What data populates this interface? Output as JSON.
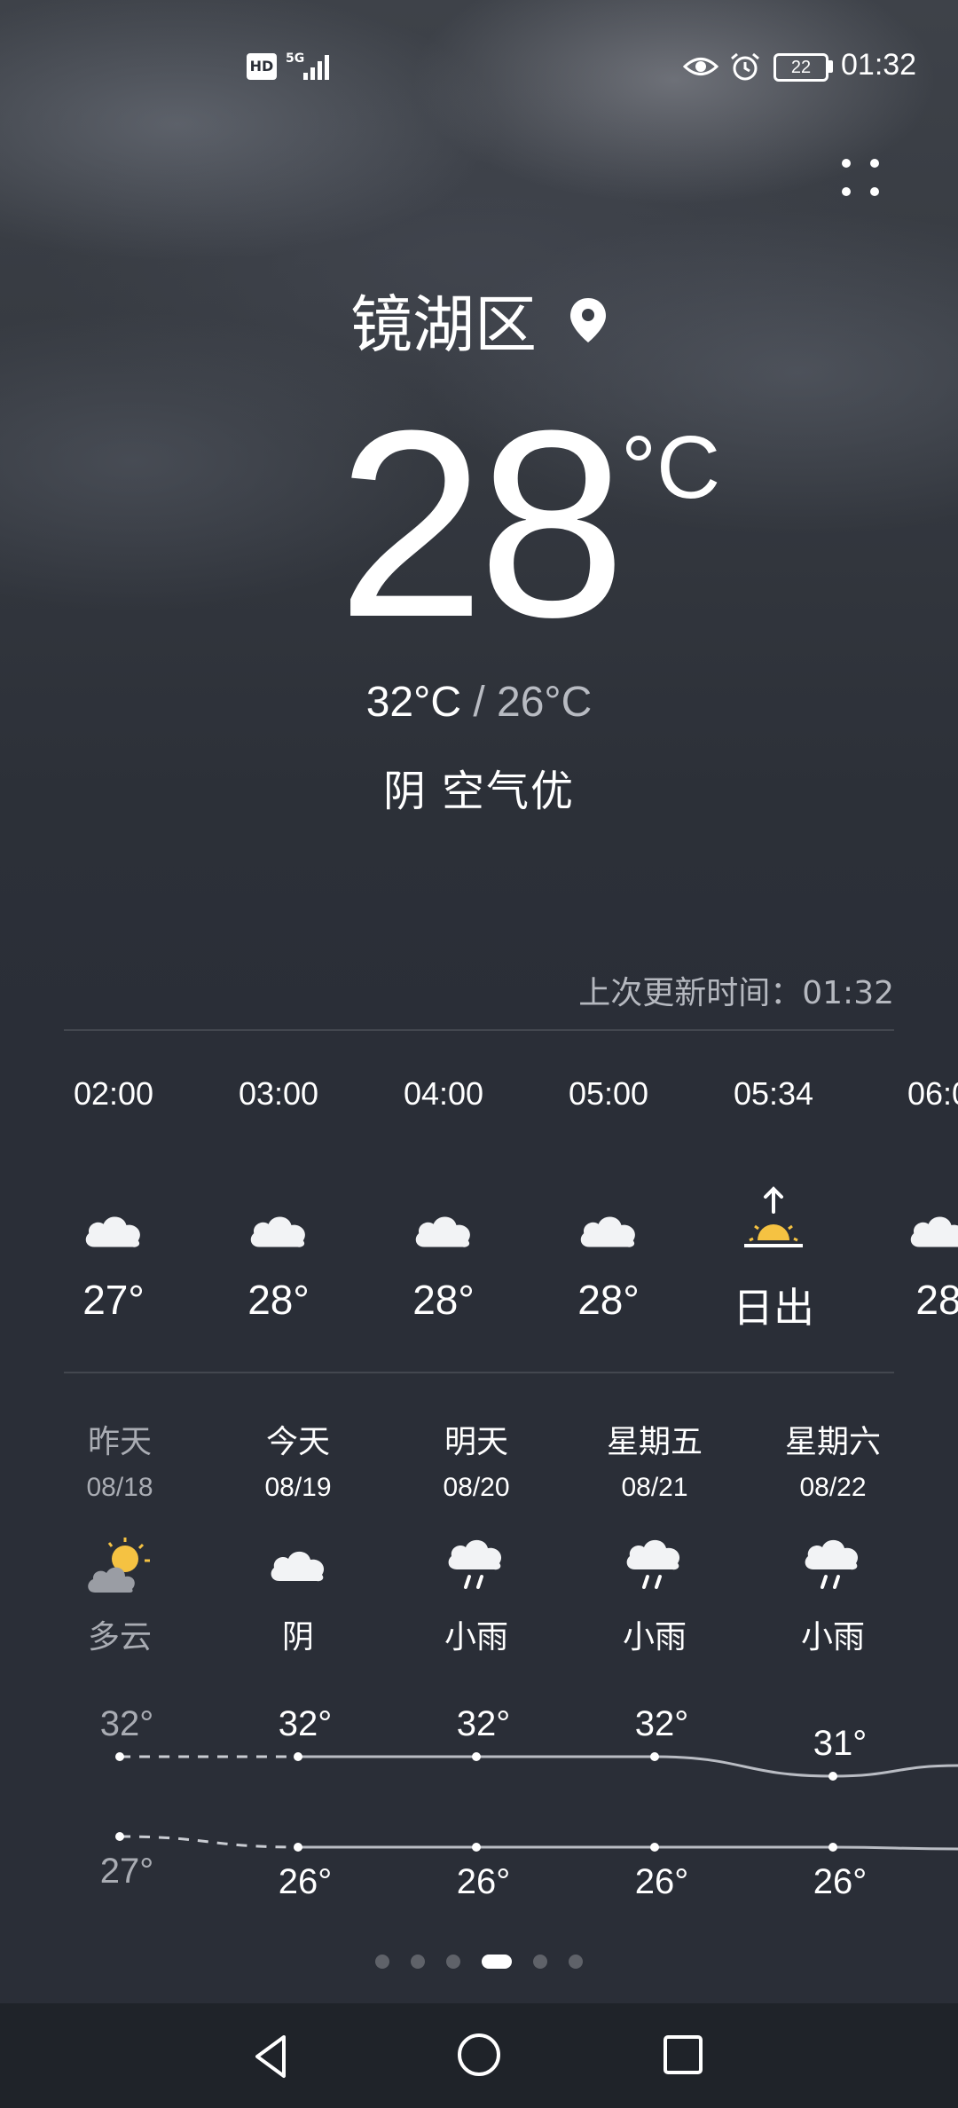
{
  "status_bar": {
    "hd_label": "HD",
    "network_label": "5G",
    "battery": "22",
    "time": "01:32"
  },
  "location": {
    "city": "镜湖区"
  },
  "current": {
    "temperature": "28",
    "unit": "°C",
    "high": "32°C",
    "low": "26°C",
    "separator": "/",
    "condition": "阴",
    "air_quality": "空气优"
  },
  "updated": {
    "text": "上次更新时间：01:32"
  },
  "hourly": [
    {
      "time": "02:00",
      "icon": "cloud-icon",
      "temp": "27°"
    },
    {
      "time": "03:00",
      "icon": "cloud-icon",
      "temp": "28°"
    },
    {
      "time": "04:00",
      "icon": "cloud-icon",
      "temp": "28°"
    },
    {
      "time": "05:00",
      "icon": "cloud-icon",
      "temp": "28°"
    },
    {
      "time": "05:34",
      "icon": "sunrise-icon",
      "temp": "日出"
    },
    {
      "time": "06:0",
      "icon": "cloud-icon",
      "temp": "28"
    }
  ],
  "daily": [
    {
      "name": "昨天",
      "date": "08/18",
      "icon": "partly-cloudy-icon",
      "condition": "多云",
      "high": "32°",
      "low": "27°",
      "past": true
    },
    {
      "name": "今天",
      "date": "08/19",
      "icon": "cloud-icon",
      "condition": "阴",
      "high": "32°",
      "low": "26°",
      "past": false
    },
    {
      "name": "明天",
      "date": "08/20",
      "icon": "light-rain-icon",
      "condition": "小雨",
      "high": "32°",
      "low": "26°",
      "past": false
    },
    {
      "name": "星期五",
      "date": "08/21",
      "icon": "light-rain-icon",
      "condition": "小雨",
      "high": "32°",
      "low": "26°",
      "past": false
    },
    {
      "name": "星期六",
      "date": "08/22",
      "icon": "light-rain-icon",
      "condition": "小雨",
      "high": "31°",
      "low": "26°",
      "past": false
    }
  ],
  "chart_data": {
    "type": "line",
    "categories": [
      "08/18",
      "08/19",
      "08/20",
      "08/21",
      "08/22"
    ],
    "series": [
      {
        "values": [
          32,
          32,
          32,
          32,
          31
        ]
      },
      {
        "values": [
          27,
          26,
          26,
          26,
          26
        ]
      }
    ]
  },
  "pager": {
    "count": 6,
    "active": 3
  },
  "colors": {
    "background": "#2a2e37",
    "sun": "#f5c242",
    "muted_text": "#a9acb3"
  }
}
